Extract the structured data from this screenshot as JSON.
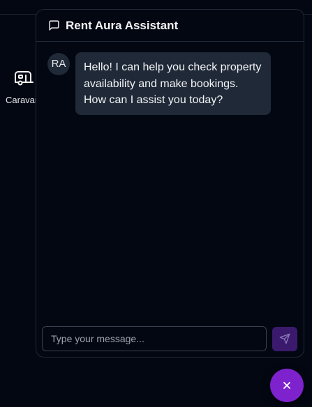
{
  "background": {
    "category": {
      "label": "Caravan",
      "icon": "caravan-icon"
    }
  },
  "chat": {
    "header": {
      "title": "Rent Aura Assistant",
      "icon": "message-square-icon"
    },
    "messages": [
      {
        "sender": "assistant",
        "avatar_initials": "RA",
        "text": "Hello! I can help you check property availability and make bookings. How can I assist you today?"
      }
    ],
    "input": {
      "placeholder": "Type your message...",
      "value": ""
    },
    "send_button": {
      "icon": "send-icon"
    }
  },
  "fab": {
    "icon": "close-icon"
  },
  "colors": {
    "background": "#030712",
    "border": "#1f2937",
    "bubble": "#1f2937",
    "send_button": "#3b1a6e",
    "fab": "#7e22ce"
  }
}
